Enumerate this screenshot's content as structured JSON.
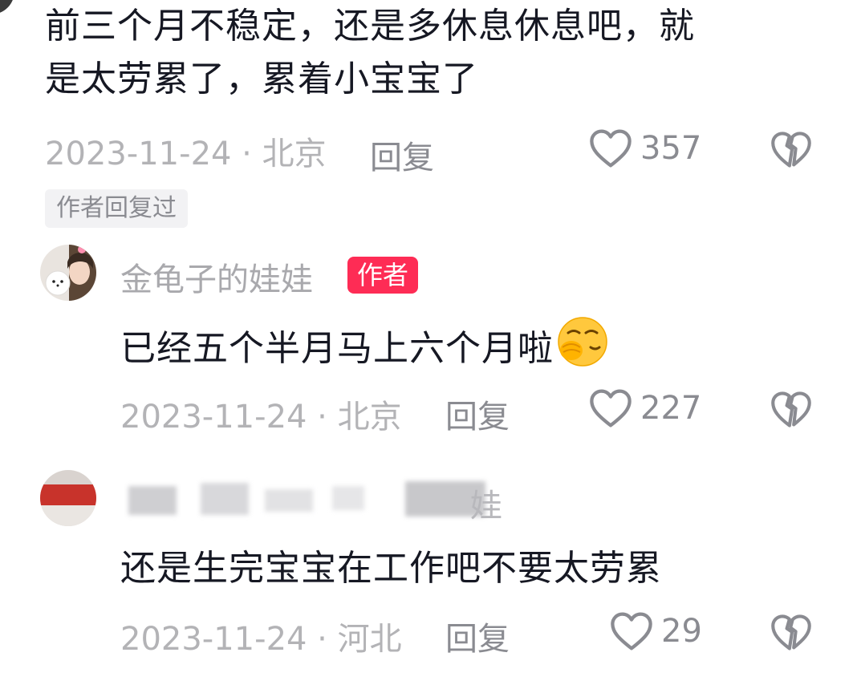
{
  "comments": [
    {
      "text": "前三个月不稳定，还是多休息休息吧，就",
      "text_line2": "是太劳累了，累着小宝宝了",
      "date_location": "2023-11-24 · 北京",
      "reply_label": "回复",
      "likes": "357",
      "author_replied_tag": "作者回复过"
    },
    {
      "username": "金龟子的娃娃",
      "badge": "作者",
      "text": "已经五个半月马上六个月啦",
      "emoji": "hand-over-mouth-emoji",
      "date_location": "2023-11-24 · 北京",
      "reply_label": "回复",
      "likes": "227"
    },
    {
      "username_visible_fragment": "娃",
      "text": "还是生完宝宝在工作吧不要太劳累",
      "date_location": "2023-11-24 · 河北",
      "reply_label": "回复",
      "likes": "29"
    }
  ],
  "icons": {
    "like": "heart-outline-icon",
    "dislike": "broken-heart-icon"
  },
  "colors": {
    "badge_bg": "#fe2c55",
    "meta_text": "#b3b3b6",
    "secondary_text": "#8a8b91",
    "primary_text": "#161823"
  }
}
